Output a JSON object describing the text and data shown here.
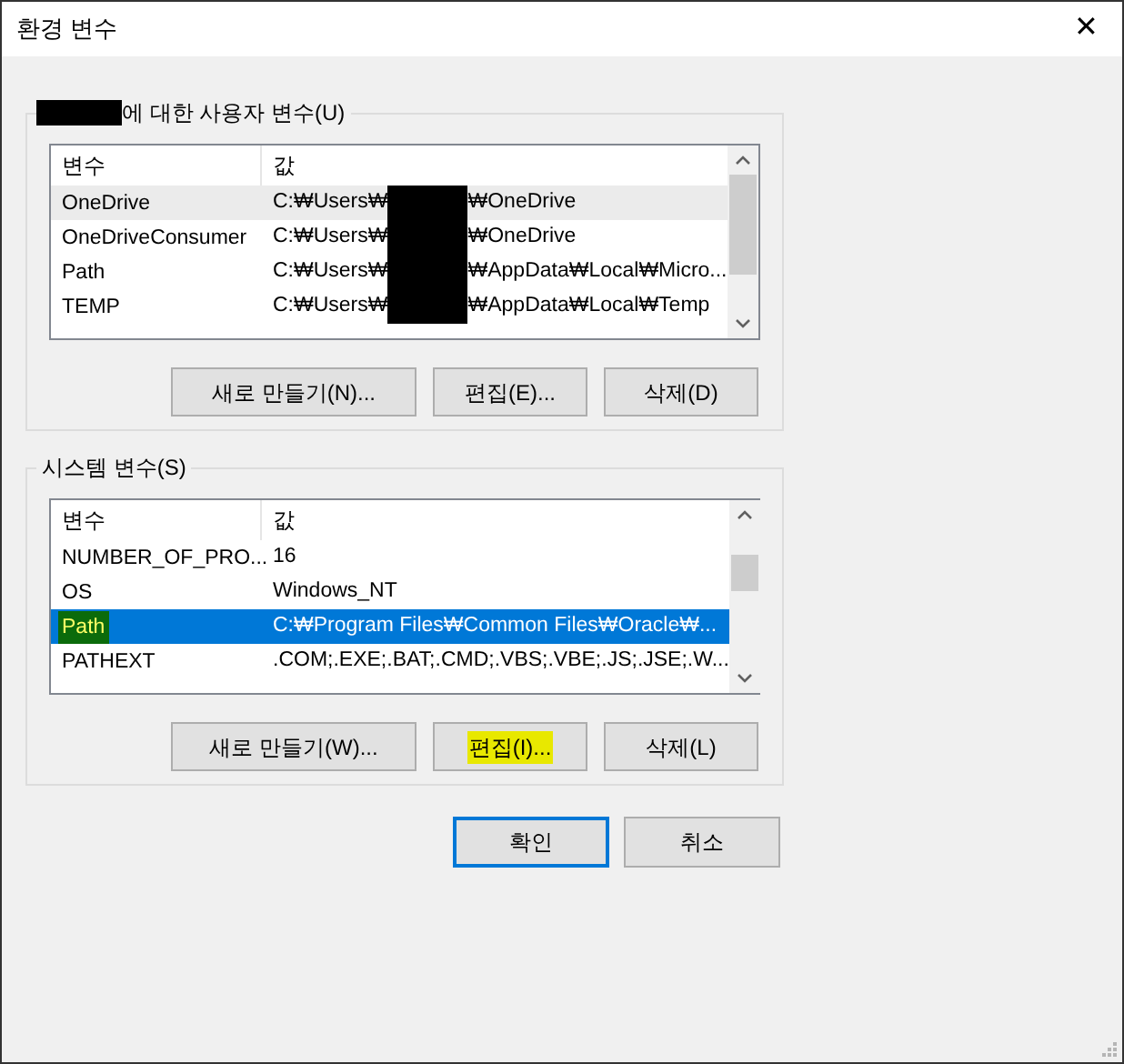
{
  "window": {
    "title": "환경 변수",
    "close": "✕"
  },
  "groups": [
    {
      "legend": "에 대한 사용자 변수(U)",
      "legend_redacted": true,
      "focused": false,
      "columns": [
        "변수",
        "값"
      ],
      "rows": [
        {
          "name": "OneDrive",
          "value_before": "C:₩Users₩",
          "value_after": "₩OneDrive",
          "redacted": true,
          "selected": true
        },
        {
          "name": "OneDriveConsumer",
          "value_before": "C:₩Users₩",
          "value_after": "₩OneDrive",
          "redacted": true,
          "selected": false
        },
        {
          "name": "Path",
          "value_before": "C:₩Users₩",
          "value_after": "₩AppData₩Local₩Micro...",
          "redacted": true,
          "selected": false
        },
        {
          "name": "TEMP",
          "value_before": "C:₩Users₩",
          "value_after": "₩AppData₩Local₩Temp",
          "redacted": true,
          "selected": false
        }
      ],
      "buttons": [
        {
          "label": "새로 만들기(N)..."
        },
        {
          "label": "편집(E)..."
        },
        {
          "label": "삭제(D)"
        }
      ]
    },
    {
      "legend": "시스템 변수(S)",
      "legend_redacted": false,
      "focused": true,
      "columns": [
        "변수",
        "값"
      ],
      "rows": [
        {
          "name": "NUMBER_OF_PRO...",
          "value_before": "16",
          "redacted": false,
          "selected": false
        },
        {
          "name": "OS",
          "value_before": "Windows_NT",
          "redacted": false,
          "selected": false
        },
        {
          "name": "Path",
          "value_before": "C:₩Program Files₩Common Files₩Oracle₩...",
          "redacted": false,
          "selected": true,
          "color": "#0b6b0b"
        },
        {
          "name": "PATHEXT",
          "value_before": ".COM;.EXE;.BAT;.CMD;.VBS;.VBE;.JS;.JSE;.W...",
          "redacted": false,
          "selected": false
        }
      ],
      "buttons": [
        {
          "label": "새로 만들기(W)..."
        },
        {
          "label": "편집(I)...",
          "color": "#e8e800"
        },
        {
          "label": "삭제(L)"
        }
      ]
    }
  ],
  "footer": [
    {
      "label": "확인",
      "default": true
    },
    {
      "label": "취소",
      "default": false
    }
  ]
}
